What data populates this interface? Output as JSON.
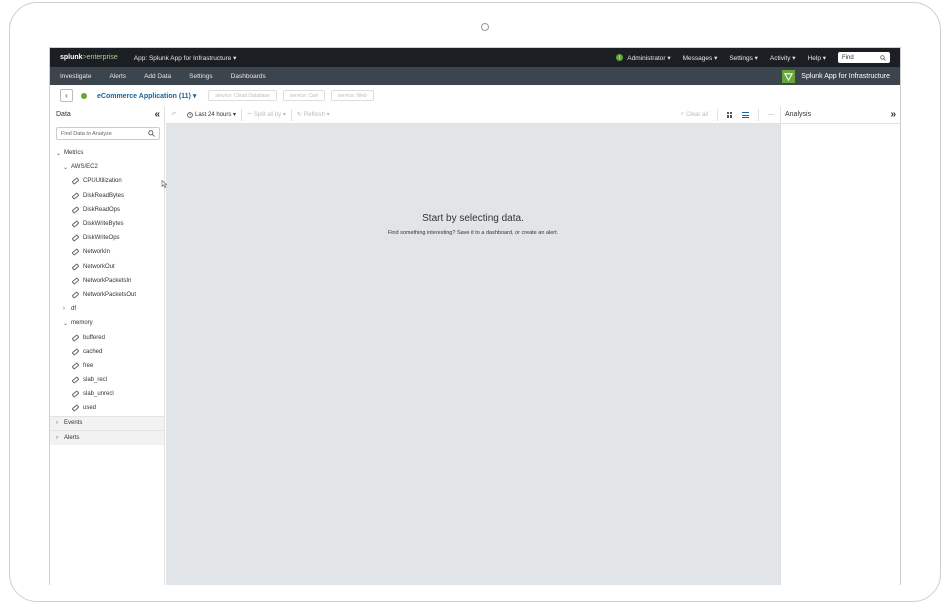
{
  "topbar": {
    "logo_main": "splunk",
    "logo_gt": ">",
    "logo_suffix": "enterprise",
    "app_menu": "App: Splunk App for Infrastructure ▾",
    "info_icon": "i",
    "admin": "Administrator ▾",
    "messages": "Messages ▾",
    "settings": "Settings ▾",
    "activity": "Activity ▾",
    "help": "Help ▾",
    "find_placeholder": "Find"
  },
  "navbar": {
    "items": [
      "Investigate",
      "Alerts",
      "Add Data",
      "Settings",
      "Dashboards"
    ],
    "app_title": "Splunk App for Infrastructure"
  },
  "crumb": {
    "back": "‹",
    "app_name": "eCommerce Application (11) ▾",
    "pills": [
      "service: Cloud Database",
      "service: Cart",
      "service: Web"
    ]
  },
  "sidebar": {
    "title": "Data",
    "collapse": "«",
    "search_placeholder": "Find Data to Analyze",
    "metrics_label": "Metrics",
    "aws_label": "AWS/EC2",
    "aws_items": [
      "CPUUtilization",
      "DiskReadBytes",
      "DiskReadOps",
      "DiskWriteBytes",
      "DiskWriteOps",
      "NetworkIn",
      "NetworkOut",
      "NetworkPacketsIn",
      "NetworkPacketsOut"
    ],
    "df_label": "df",
    "memory_label": "memory",
    "memory_items": [
      "buffered",
      "cached",
      "free",
      "slab_recl",
      "slab_unrecl",
      "used"
    ],
    "events_label": "Events",
    "alerts_label": "Alerts"
  },
  "toolbar": {
    "undo": "↶",
    "time_range": "Last 24 hours ▾",
    "split_by": "Split all by ▾",
    "refresh": "Refresh ▾",
    "clear_all": "Clear all",
    "more": "···"
  },
  "canvas": {
    "title": "Start by selecting data.",
    "subtitle": "Find something interesting? Save it to a dashboard, or create an alert."
  },
  "analysis": {
    "title": "Analysis",
    "expand": "»"
  },
  "colors": {
    "brand_green": "#65a637",
    "topbar_bg": "#1b1e22",
    "navbar_bg": "#3c444d",
    "canvas_bg": "#e1e5e8",
    "link_blue": "#1a6496"
  }
}
